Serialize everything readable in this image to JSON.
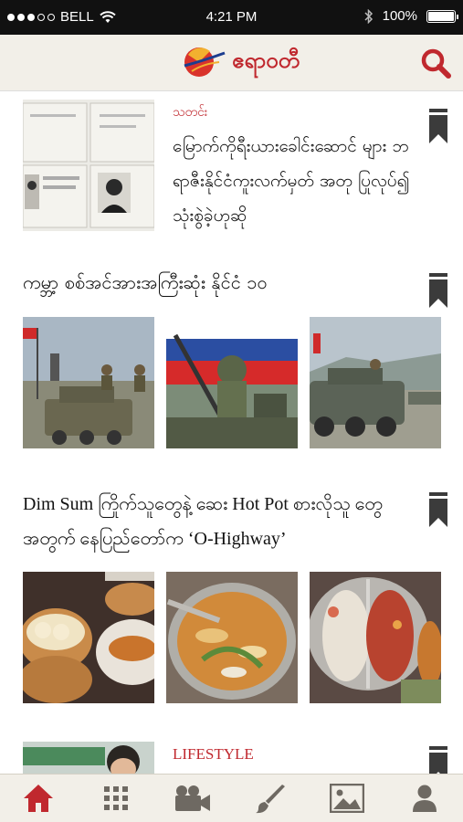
{
  "status_bar": {
    "carrier": "BELL",
    "time": "4:21 PM",
    "battery": "100%"
  },
  "header": {
    "logo_text": "ဧရာဝတီ",
    "search_icon": "search-icon"
  },
  "articles": [
    {
      "category": "သတင်း",
      "title": "မြောက်ကိုရီးယားခေါင်းဆောင် များ ဘရာဇီးနိုင်ငံကူးလက်မှတ် အတု ပြုလုပ်၍ သုံးစွဲခဲ့ဟုဆို"
    },
    {
      "title": "ကမ္ဘာ့ စစ်အင်အားအကြီးဆုံး နိုင်ငံ ၁၀"
    },
    {
      "title": "Dim Sum ကြိုက်သူတွေနဲ့ ဆေး Hot Pot စားလိုသူ တွေအတွက် နေပြည်တော်က ‘O-Highway’"
    },
    {
      "category": "LIFESTYLE"
    }
  ],
  "tabbar": {
    "items": [
      "home-icon",
      "grid-icon",
      "video-camera-icon",
      "paintbrush-icon",
      "photo-icon",
      "profile-icon"
    ],
    "active": "home-icon",
    "active_color": "#c0282e",
    "inactive_color": "#6e6962"
  },
  "colors": {
    "accent": "#c0282e",
    "header_bg": "#f2efe8"
  }
}
